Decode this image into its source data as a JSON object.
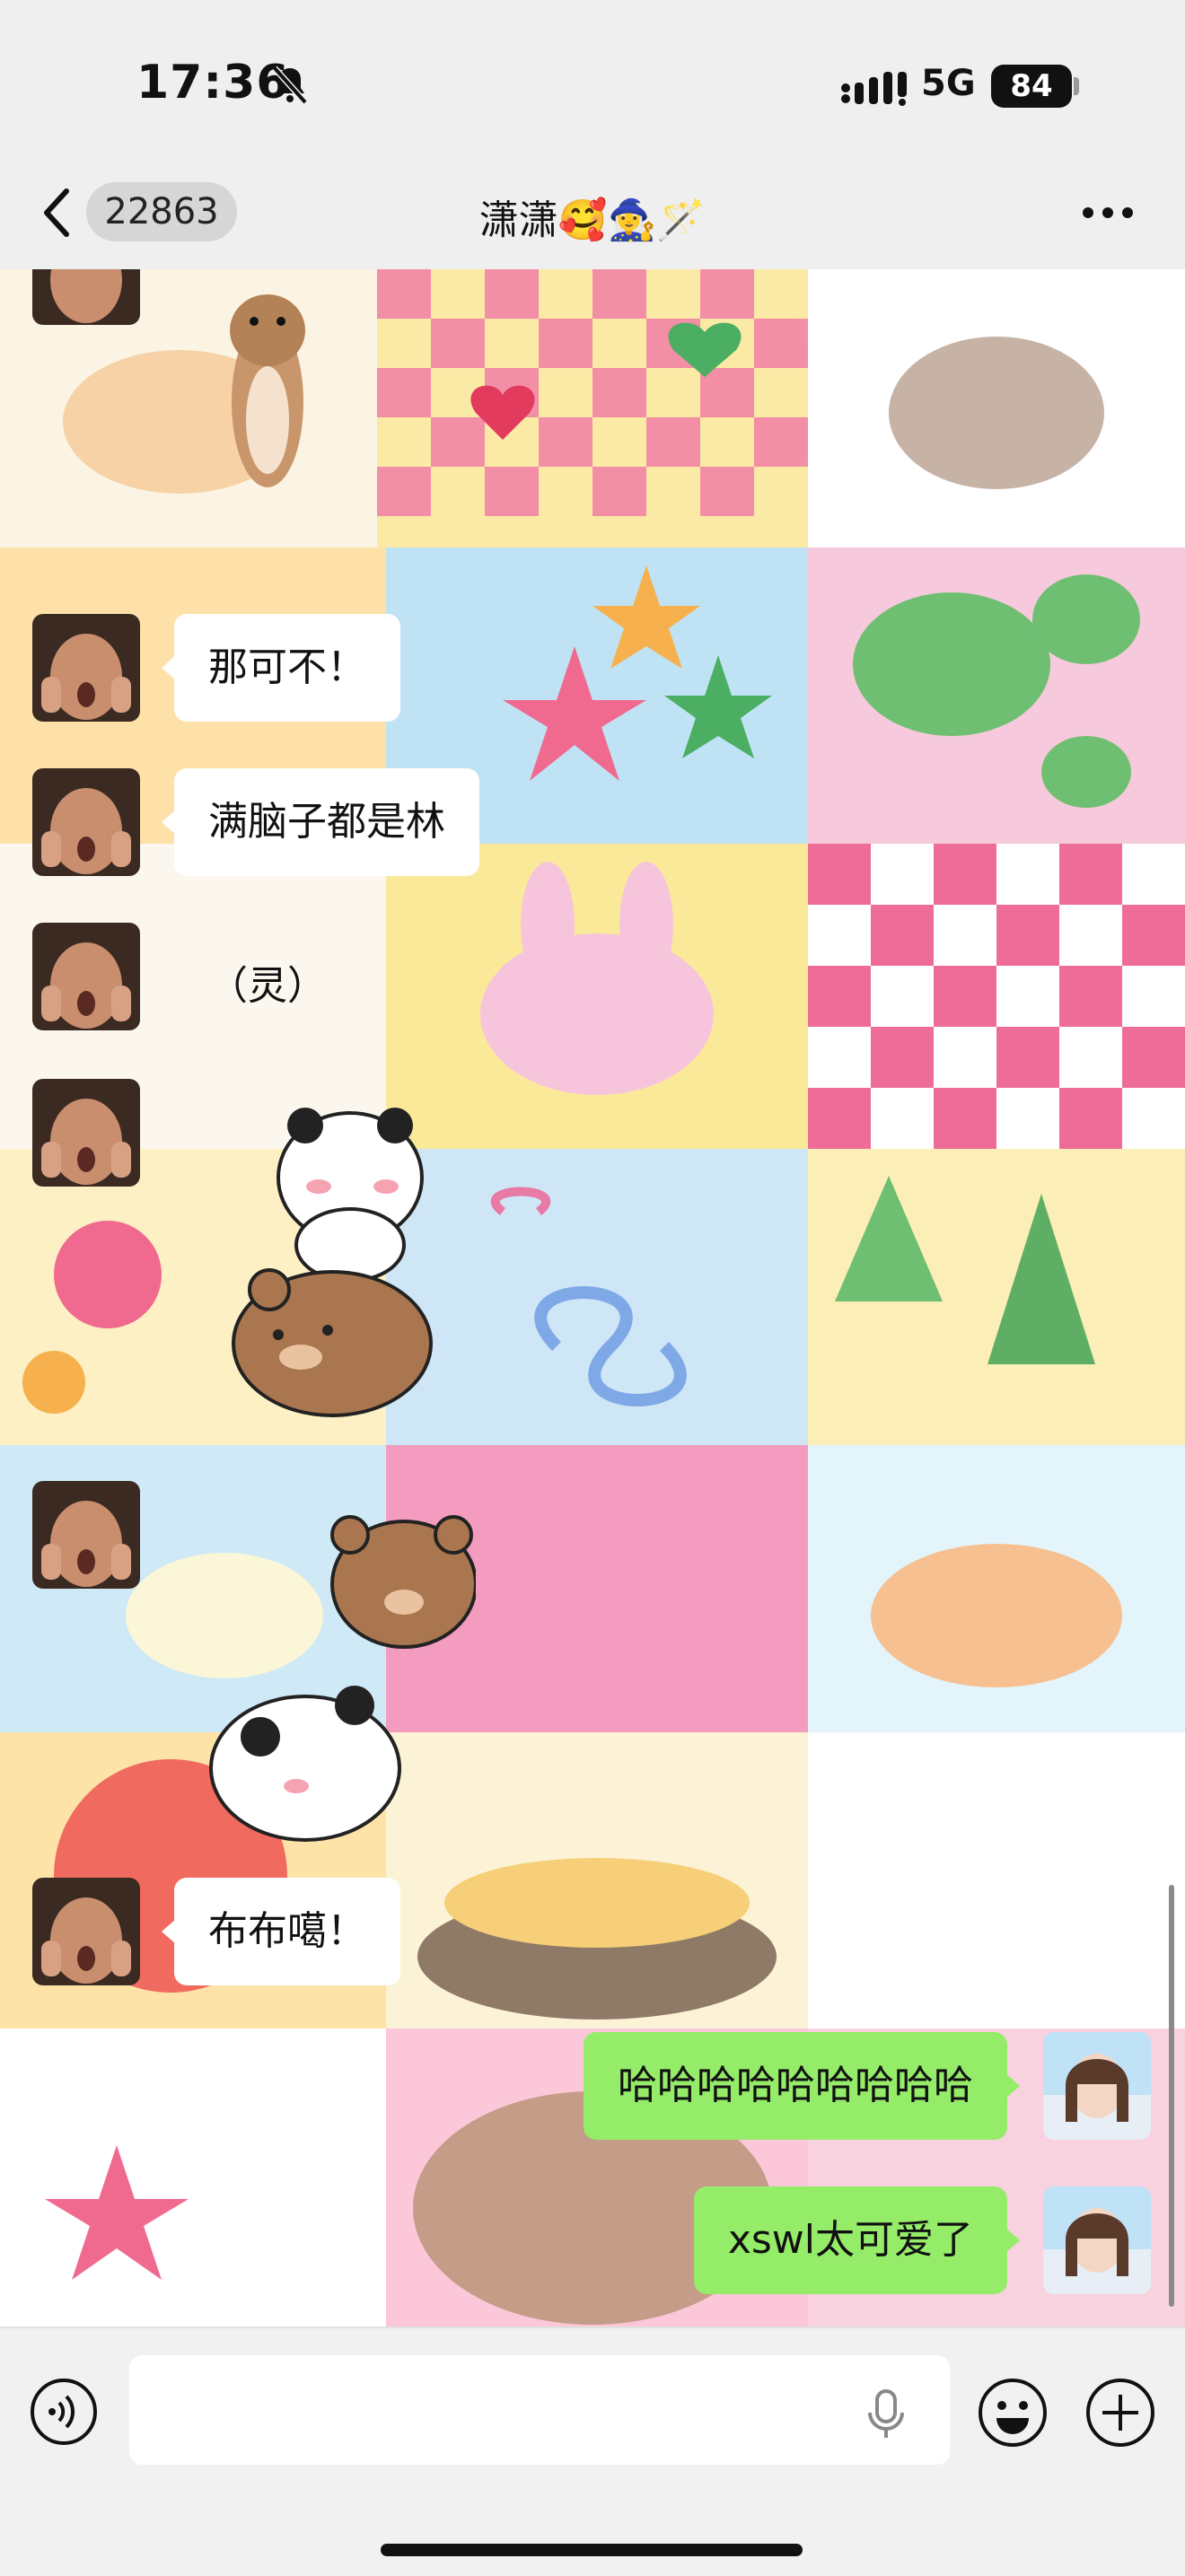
{
  "status_bar": {
    "time": "17:36",
    "network": "5G",
    "battery": "84"
  },
  "nav": {
    "unread_count": "22863",
    "title": "潇潇🥰🧙‍♀️🪄",
    "icons": [
      "back-chevron-icon",
      "more-dots-icon"
    ]
  },
  "messages": [
    {
      "from": "contact",
      "type": "sticker",
      "sticker": "hamster-sticker"
    },
    {
      "from": "contact",
      "type": "text",
      "text": "那可不！"
    },
    {
      "from": "contact",
      "type": "text",
      "text": "满脑子都是林"
    },
    {
      "from": "contact",
      "type": "text",
      "text": "（灵）"
    },
    {
      "from": "contact",
      "type": "sticker",
      "sticker": "panda-bear-stack-sticker"
    },
    {
      "from": "contact",
      "type": "sticker",
      "sticker": "bear-panda-hug-sticker"
    },
    {
      "from": "contact",
      "type": "text",
      "text": "布布噶！"
    },
    {
      "from": "me",
      "type": "text",
      "text": "哈哈哈哈哈哈哈哈哈"
    },
    {
      "from": "me",
      "type": "text",
      "text": "xswl太可爱了"
    }
  ],
  "input_bar": {
    "placeholder": "",
    "icons": [
      "voice-icon",
      "mic-icon",
      "emoji-icon",
      "plus-icon"
    ]
  },
  "colors": {
    "outgoing_bubble": "#95ec69",
    "incoming_bubble": "#ffffff",
    "bar_background": "#efefef"
  }
}
